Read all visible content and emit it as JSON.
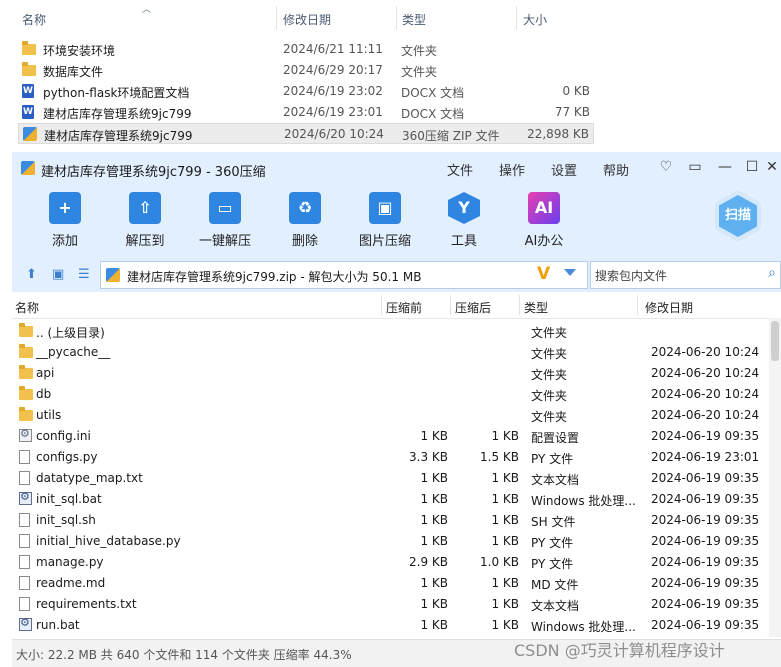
{
  "explorer": {
    "columns": {
      "name": "名称",
      "date": "修改日期",
      "type": "类型",
      "size": "大小"
    },
    "files": [
      {
        "icon": "folder-icon",
        "name": "环境安装环境",
        "date": "2024/6/21 11:11",
        "type": "文件夹",
        "size": ""
      },
      {
        "icon": "folder-icon",
        "name": "数据库文件",
        "date": "2024/6/29 20:17",
        "type": "文件夹",
        "size": ""
      },
      {
        "icon": "docx-icon",
        "name": "python-flask环境配置文档",
        "date": "2024/6/19 23:02",
        "type": "DOCX 文档",
        "size": "0 KB"
      },
      {
        "icon": "docx-icon",
        "name": "建材店库存管理系统9jc799",
        "date": "2024/6/19 23:01",
        "type": "DOCX 文档",
        "size": "77 KB"
      },
      {
        "icon": "zip-icon",
        "name": "建材店库存管理系统9jc799",
        "date": "2024/6/20 10:24",
        "type": "360压缩 ZIP 文件",
        "size": "22,898 KB"
      }
    ]
  },
  "window": {
    "title": "建材店库存管理系统9jc799 - 360压缩",
    "menu": [
      "文件",
      "操作",
      "设置",
      "帮助"
    ],
    "toolbar": {
      "add": "添加",
      "extract": "解压到",
      "one_click": "一键解压",
      "delete": "删除",
      "image_compress": "图片压缩",
      "tools": "工具",
      "ai_office": "AI办公",
      "scan": "扫描",
      "ai_badge": "AI"
    },
    "address": "建材店库存管理系统9jc799.zip - 解包大小为 50.1 MB",
    "search_placeholder": "搜索包内文件",
    "columns": {
      "name": "名称",
      "compressed": "压缩前",
      "uncompressed": "压缩后",
      "type": "类型",
      "modified": "修改日期"
    },
    "entries": [
      {
        "icon": "folder-icon",
        "name": ".. (上级目录)",
        "before": "",
        "after": "",
        "type": "文件夹",
        "modified": ""
      },
      {
        "icon": "folder-icon",
        "name": "__pycache__",
        "before": "",
        "after": "",
        "type": "文件夹",
        "modified": "2024-06-20 10:24"
      },
      {
        "icon": "folder-icon",
        "name": "api",
        "before": "",
        "after": "",
        "type": "文件夹",
        "modified": "2024-06-20 10:24"
      },
      {
        "icon": "folder-icon",
        "name": "db",
        "before": "",
        "after": "",
        "type": "文件夹",
        "modified": "2024-06-20 10:24"
      },
      {
        "icon": "folder-icon",
        "name": "utils",
        "before": "",
        "after": "",
        "type": "文件夹",
        "modified": "2024-06-20 10:24"
      },
      {
        "icon": "config-file-icon",
        "name": "config.ini",
        "before": "1 KB",
        "after": "1 KB",
        "type": "配置设置",
        "modified": "2024-06-19 09:35"
      },
      {
        "icon": "file-icon",
        "name": "configs.py",
        "before": "3.3 KB",
        "after": "1.5 KB",
        "type": "PY 文件",
        "modified": "2024-06-19 23:01"
      },
      {
        "icon": "file-icon",
        "name": "datatype_map.txt",
        "before": "1 KB",
        "after": "1 KB",
        "type": "文本文档",
        "modified": "2024-06-19 09:35"
      },
      {
        "icon": "batch-file-icon",
        "name": "init_sql.bat",
        "before": "1 KB",
        "after": "1 KB",
        "type": "Windows 批处理...",
        "modified": "2024-06-19 09:35"
      },
      {
        "icon": "file-icon",
        "name": "init_sql.sh",
        "before": "1 KB",
        "after": "1 KB",
        "type": "SH 文件",
        "modified": "2024-06-19 09:35"
      },
      {
        "icon": "file-icon",
        "name": "initial_hive_database.py",
        "before": "1 KB",
        "after": "1 KB",
        "type": "PY 文件",
        "modified": "2024-06-19 09:35"
      },
      {
        "icon": "file-icon",
        "name": "manage.py",
        "before": "2.9 KB",
        "after": "1.0 KB",
        "type": "PY 文件",
        "modified": "2024-06-19 09:35"
      },
      {
        "icon": "file-icon",
        "name": "readme.md",
        "before": "1 KB",
        "after": "1 KB",
        "type": "MD 文件",
        "modified": "2024-06-19 09:35"
      },
      {
        "icon": "file-icon",
        "name": "requirements.txt",
        "before": "1 KB",
        "after": "1 KB",
        "type": "文本文档",
        "modified": "2024-06-19 09:35"
      },
      {
        "icon": "batch-file-icon",
        "name": "run.bat",
        "before": "1 KB",
        "after": "1 KB",
        "type": "Windows 批处理...",
        "modified": "2024-06-19 09:35"
      }
    ],
    "status": "大小: 22.2 MB 共 640 个文件和 114 个文件夹 压缩率 44.3%"
  },
  "watermark": "CSDN @巧灵计算机程序设计"
}
